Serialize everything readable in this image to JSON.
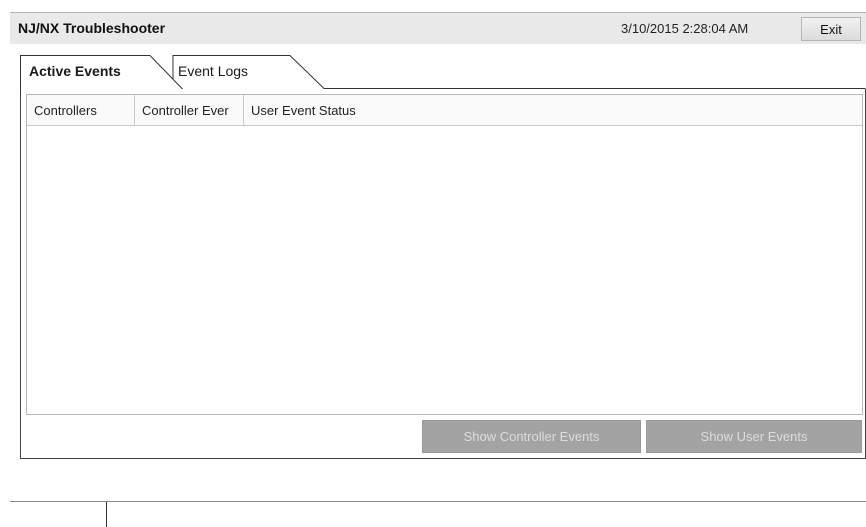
{
  "window": {
    "title": "NJ/NX Troubleshooter",
    "datetime": "3/10/2015 2:28:04 AM",
    "exit_label": "Exit"
  },
  "tabs": [
    {
      "label": "Active Events",
      "selected": true
    },
    {
      "label": "Event Logs",
      "selected": false
    }
  ],
  "grid": {
    "columns": [
      "Controllers",
      "Controller Ever",
      "User Event Status"
    ],
    "rows": []
  },
  "actions": {
    "show_controller_events": "Show Controller Events",
    "show_user_events": "Show User Events"
  },
  "colors": {
    "titlebar_bg": "#e9e9e9",
    "disabled_button_bg": "#a3a3a3",
    "disabled_button_text": "#dcdcdc"
  }
}
